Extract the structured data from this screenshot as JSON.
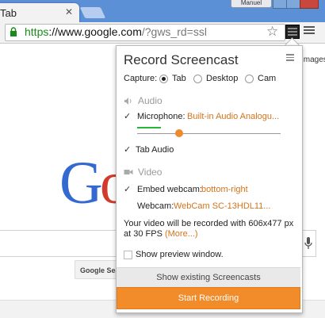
{
  "browser": {
    "tab_title": "Tab",
    "tab_close": "✕",
    "user_name": "Manuel",
    "url": {
      "scheme": "https",
      "sep": "://",
      "host": "www.google.com",
      "path": "/?gws_rd=ssl"
    }
  },
  "page": {
    "images_link": "Images",
    "search_button": "Google Search",
    "logo_letters": [
      "G",
      "o"
    ]
  },
  "panel": {
    "title": "Record Screencast",
    "capture": {
      "label": "Capture:",
      "options": [
        "Tab",
        "Desktop",
        "Cam"
      ],
      "selected": "Tab"
    },
    "audio": {
      "header": "Audio",
      "microphone": {
        "checked": true,
        "label": "Microphone:",
        "value": "Built-in Audio Analogu..."
      },
      "tab_audio": {
        "checked": true,
        "label": "Tab Audio"
      }
    },
    "video": {
      "header": "Video",
      "embed_webcam": {
        "checked": true,
        "label": "Embed webcam:",
        "value": "bottom-right"
      },
      "webcam": {
        "label": "Webcam:",
        "value": "WebCam SC-13HDL11..."
      }
    },
    "info": {
      "text": "Your video will be recorded with 606x477 px at 30 FPS",
      "more": "(More...)"
    },
    "preview": {
      "checked": false,
      "label": "Show preview window."
    },
    "show_button": "Show existing Screencasts",
    "start_button": "Start Recording"
  },
  "colors": {
    "accent": "#f28c2b",
    "link": "#d4731c",
    "level": "#2bb43a"
  }
}
